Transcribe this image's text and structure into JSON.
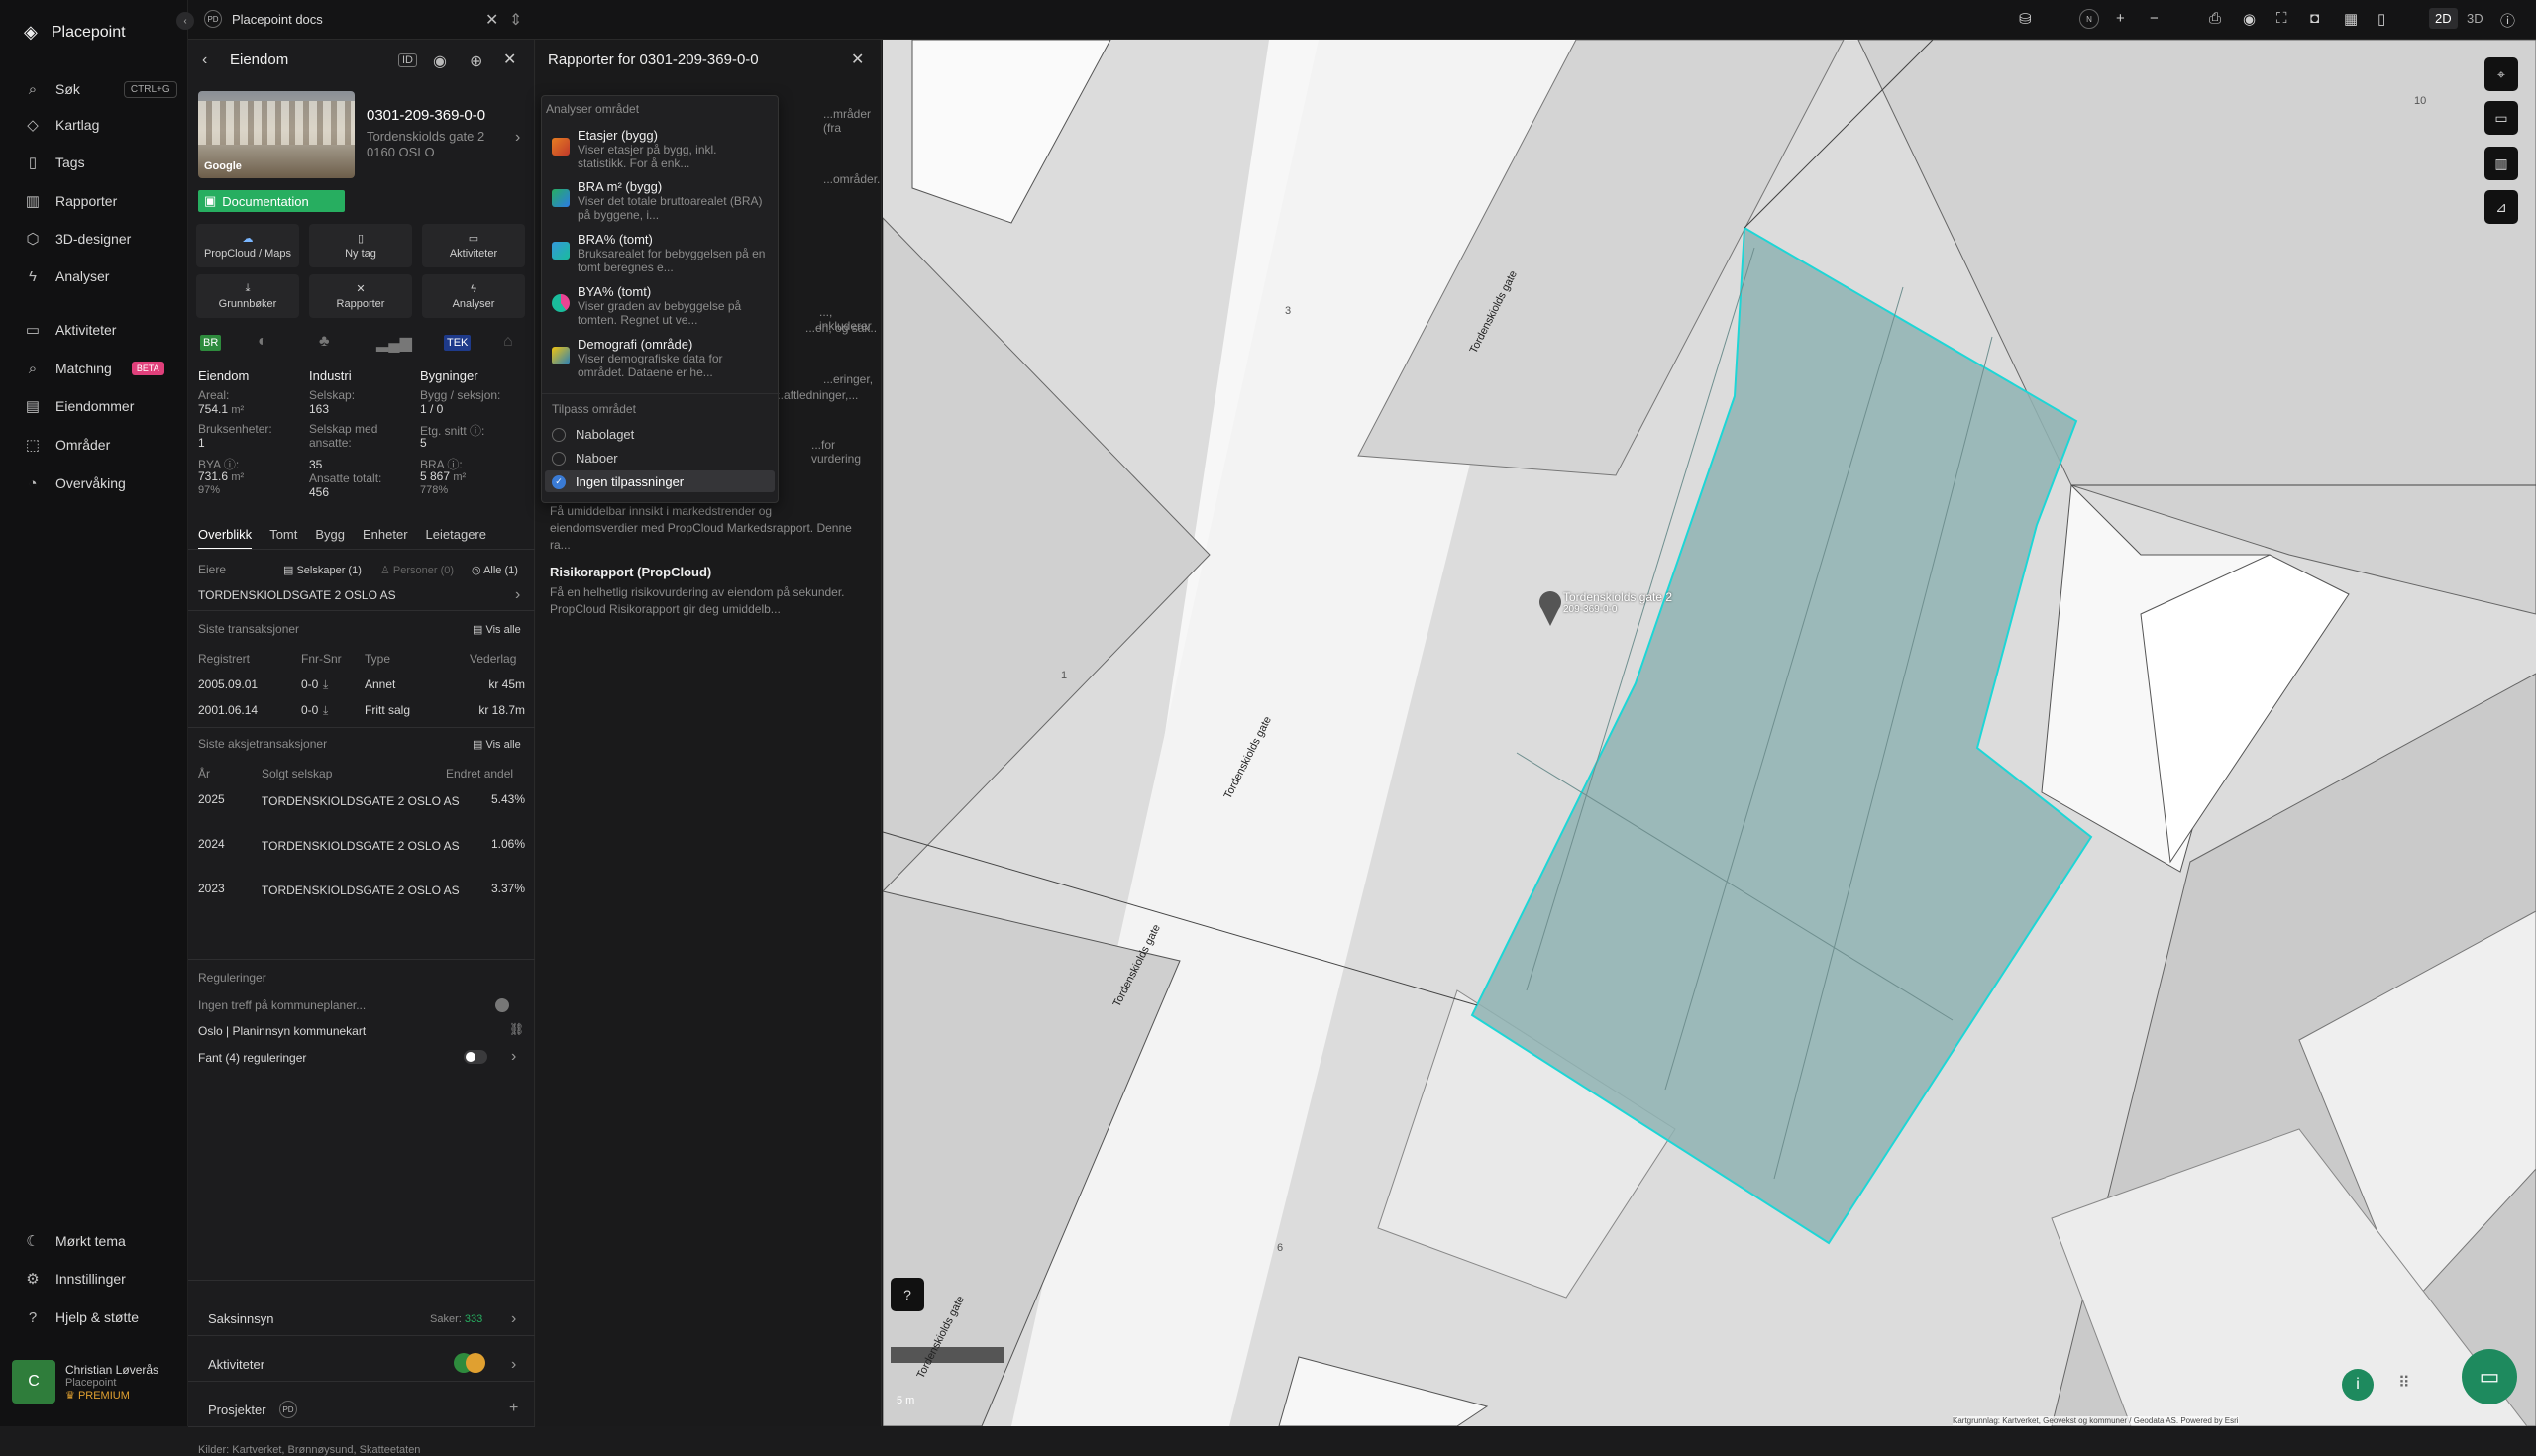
{
  "brand": {
    "name": "Placepoint"
  },
  "nav": {
    "items": [
      {
        "label": "Søk",
        "shortcut": "CTRL+G"
      },
      {
        "label": "Kartlag"
      },
      {
        "label": "Tags"
      },
      {
        "label": "Rapporter"
      },
      {
        "label": "3D-designer"
      },
      {
        "label": "Analyser"
      },
      {
        "label": "Aktiviteter"
      },
      {
        "label": "Matching",
        "badge": "BETA"
      },
      {
        "label": "Eiendommer"
      },
      {
        "label": "Områder"
      },
      {
        "label": "Overvåking"
      }
    ],
    "bottom": [
      {
        "label": "Mørkt tema"
      },
      {
        "label": "Innstillinger"
      },
      {
        "label": "Hjelp & støtte"
      }
    ],
    "user": {
      "initial": "C",
      "name": "Christian Løverås",
      "org": "Placepoint",
      "tier": "PREMIUM"
    }
  },
  "topbar": {
    "workspace_badge": "PD",
    "workspace": "Placepoint docs",
    "compass": "N",
    "mode2d": "2D",
    "mode3d": "3D"
  },
  "property": {
    "panel_title": "Eiendom",
    "id": "0301-209-369-0-0",
    "address": "Tordenskiolds gate 2",
    "postal": "0160 OSLO",
    "photo_credit": "Google",
    "doc_button": "Documentation",
    "actions": [
      {
        "label": "PropCloud / Maps"
      },
      {
        "label": "Ny tag"
      },
      {
        "label": "Aktiviteter"
      },
      {
        "label": "Grunnbøker"
      },
      {
        "label": "Rapporter"
      },
      {
        "label": "Analyser"
      }
    ],
    "stats": {
      "col1_title": "Eiendom",
      "col2_title": "Industri",
      "col3_title": "Bygninger",
      "areal_label": "Areal:",
      "areal": "754.1",
      "areal_unit": "m²",
      "selskap_label": "Selskap:",
      "selskap": "163",
      "bygg_label": "Bygg / seksjon:",
      "bygg": "1 / 0",
      "bruks_label": "Bruksenheter:",
      "bruks": "1",
      "ansatte_label": "Selskap med ansatte:",
      "ansatte": "35",
      "etg_label": "Etg. snitt",
      "etg": "5",
      "bya_label": "BYA",
      "bya": "731.6",
      "bya_unit": "m²",
      "bya_pct": "97%",
      "ans_tot_label": "Ansatte totalt:",
      "ans_tot": "456",
      "bra_label": "BRA",
      "bra": "5 867",
      "bra_unit": "m²",
      "bra_pct": "778%"
    },
    "tabs": [
      "Overblikk",
      "Tomt",
      "Bygg",
      "Enheter",
      "Leietagere"
    ],
    "owners": {
      "label": "Eiere",
      "f1": "Selskaper (1)",
      "f2": "Personer (0)",
      "f3": "Alle (1)",
      "name": "TORDENSKIOLDSGATE 2 OSLO AS"
    },
    "transactions": {
      "title": "Siste transaksjoner",
      "show_all": "Vis alle",
      "headers": [
        "Registrert",
        "Fnr-Snr",
        "Type",
        "Vederlag"
      ],
      "rows": [
        [
          "2005.09.01",
          "0-0",
          "Annet",
          "kr 45m"
        ],
        [
          "2001.06.14",
          "0-0",
          "Fritt salg",
          "kr 18.7m"
        ]
      ]
    },
    "share_tx": {
      "title": "Siste aksjetransaksjoner",
      "show_all": "Vis alle",
      "headers": [
        "År",
        "Solgt selskap",
        "Endret andel"
      ],
      "rows": [
        [
          "2025",
          "TORDENSKIOLDSGATE 2 OSLO AS",
          "5.43%"
        ],
        [
          "2024",
          "TORDENSKIOLDSGATE 2 OSLO AS",
          "1.06%"
        ],
        [
          "2023",
          "TORDENSKIOLDSGATE 2 OSLO AS",
          "3.37%"
        ]
      ]
    },
    "regulations": {
      "title": "Reguleringer",
      "r1": "Ingen treff på kommuneplaner...",
      "r2": "Oslo | Planinnsyn kommunekart",
      "r3": "Fant (4) reguleringer"
    },
    "bottom_sections": {
      "saksinnsyn": "Saksinnsyn",
      "saker_label": "Saker:",
      "saker": "333",
      "aktiviteter": "Aktiviteter",
      "prosjekter": "Prosjekter",
      "prosjekter_badge": "PD"
    },
    "sources": {
      "label": "Kilder:",
      "s1": "Kartverket,",
      "s2": "Brønnøysund,",
      "s3": "Skatteetaten"
    }
  },
  "reports": {
    "title": "Rapporter for 0301-209-369-0-0",
    "bg": [
      {
        "t": "...mråder (fra"
      },
      {
        "t": "...områder."
      },
      {
        "t": "..., inkluderer"
      },
      {
        "t": "...en, og sak.."
      },
      {
        "t": "...eringer,"
      },
      {
        "t": "...aftledninger,..."
      },
      {
        "t": "...for vurdering"
      }
    ],
    "market_desc": "Få umiddelbar innsikt i markedstrender og eiendomsverdier med PropCloud Markedsrapport. Denne ra...",
    "risk_title": "Risikorapport (PropCloud)",
    "risk_desc": "Få en helhetlig risikovurdering av eiendom på sekunder. PropCloud Risikorapport gir deg umiddelb..."
  },
  "dropdown": {
    "header": "Analyser området",
    "items": [
      {
        "title": "Etasjer (bygg)",
        "desc": "Viser etasjer på bygg, inkl. statistikk. For å enk..."
      },
      {
        "title": "BRA m² (bygg)",
        "desc": "Viser det totale bruttoarealet (BRA) på byggene, i..."
      },
      {
        "title": "BRA% (tomt)",
        "desc": "Bruksarealet for bebyggelsen på en tomt beregnes e..."
      },
      {
        "title": "BYA% (tomt)",
        "desc": "Viser graden av bebyggelse på tomten. Regnet ut ve..."
      },
      {
        "title": "Demografi (område)",
        "desc": "Viser demografiske data for området. Dataene er he..."
      }
    ],
    "customize": "Tilpass området",
    "options": [
      "Nabolaget",
      "Naboer",
      "Ingen tilpassninger"
    ]
  },
  "map": {
    "marker_label": "Tordenskiolds gate 2",
    "marker_sub": "209-369-0-0",
    "street": "Tordenskiolds gate",
    "scale": "5 m",
    "attribution": "Kartgrunnlag: Kartverket, Geovekst og kommuner / Geodata AS. Powered by Esri",
    "num_10": "10",
    "num_3": "3",
    "num_1": "1",
    "num_6": "6"
  }
}
